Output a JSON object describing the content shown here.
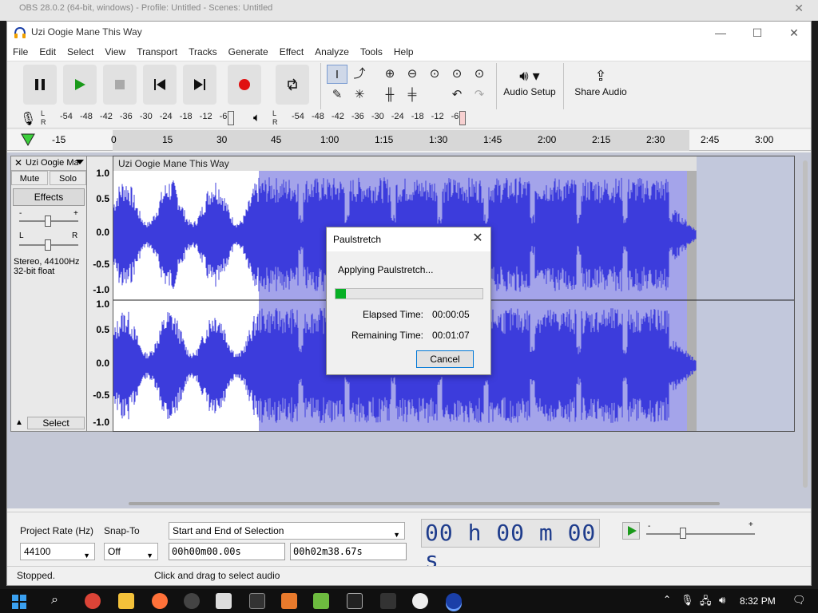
{
  "obs": {
    "title_fragment": "OBS 28.0.2 (64-bit, windows) - Profile: Untitled - Scenes: Untitled"
  },
  "window": {
    "title": "Uzi Oogie Mane This Way",
    "minimize": "—",
    "maximize": "☐",
    "close": "✕"
  },
  "menu": [
    "File",
    "Edit",
    "Select",
    "View",
    "Transport",
    "Tracks",
    "Generate",
    "Effect",
    "Analyze",
    "Tools",
    "Help"
  ],
  "toolbar": {
    "audio_setup_label": "Audio Setup",
    "share_audio_label": "Share Audio"
  },
  "meters": {
    "record_ticks": "-54 -48 -42 -36 -30 -24 -18 -12 -6",
    "play_ticks": "-54 -48 -42 -36 -30 -24 -18 -12 -6",
    "left": "L",
    "right": "R"
  },
  "timeline": {
    "ticks": [
      "-15",
      "0",
      "15",
      "30",
      "45",
      "1:00",
      "1:15",
      "1:30",
      "1:45",
      "2:00",
      "2:15",
      "2:30",
      "2:45",
      "3:00"
    ]
  },
  "track": {
    "close": "✕",
    "name": "Uzi Oogie Mane This Way",
    "mute_label": "Mute",
    "solo_label": "Solo",
    "effects_label": "Effects",
    "gain_minus": "-",
    "gain_plus": "+",
    "pan_left": "L",
    "pan_right": "R",
    "info_line1": "Stereo, 44100Hz",
    "info_line2": "32-bit float",
    "collapse": "▲",
    "select_label": "Select",
    "clip_title": "Uzi Oogie Mane This Way",
    "ruler_top": [
      "1.0",
      "0.5",
      "0.0",
      "-0.5",
      "-1.0"
    ],
    "ruler_bottom": [
      "1.0",
      "0.5",
      "0.0",
      "-0.5",
      "-1.0"
    ]
  },
  "selection_bar": {
    "project_rate_label": "Project Rate (Hz)",
    "project_rate_value": "44100",
    "snap_to_label": "Snap-To",
    "snap_to_value": "Off",
    "selection_mode": "Start and End of Selection",
    "start_time": "00h00m00.00s",
    "end_time": "00h02m38.67s",
    "big_time": "00 h 00 m 00 s"
  },
  "status": {
    "left": "Stopped.",
    "hint": "Click and drag to select audio"
  },
  "dialog": {
    "title": "Paulstretch",
    "close": "✕",
    "message": "Applying Paulstretch...",
    "progress_fraction": 0.07,
    "elapsed_label": "Elapsed Time:",
    "elapsed_value": "00:00:05",
    "remaining_label": "Remaining Time:",
    "remaining_value": "00:01:07",
    "cancel_label": "Cancel"
  },
  "taskbar": {
    "time": "8:32 PM"
  },
  "colors": {
    "waveform": "#3c3cdc",
    "selection": "#5a5ad8",
    "record": "#e01010",
    "play": "#1a9a1a",
    "progress": "#06b025"
  }
}
